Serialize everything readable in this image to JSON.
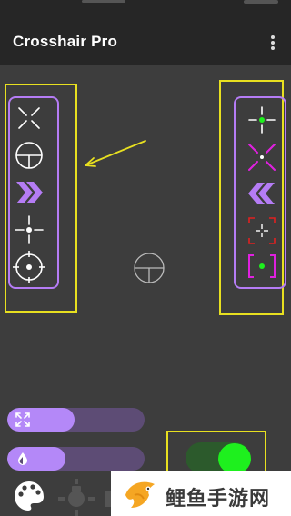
{
  "app": {
    "title": "Crosshair Pro"
  },
  "left_panel": {
    "items": [
      "x-crosshair",
      "circle-t-crosshair",
      "double-chevron-right",
      "dot-cross-crosshair",
      "circle-cross-dot-crosshair"
    ]
  },
  "right_panel": {
    "items": [
      "green-dot-cross-crosshair",
      "magenta-x-crosshair",
      "double-chevron-left",
      "red-bracket-cross-crosshair",
      "magenta-bracket-green-dot-crosshair"
    ]
  },
  "sliders": [
    {
      "name": "size",
      "icon": "expand-icon",
      "value": 0.49
    },
    {
      "name": "opacity",
      "icon": "drop-icon",
      "value": 0.42
    }
  ],
  "toggle": {
    "on": true
  },
  "colors": {
    "accent": "#b57cf5",
    "highlight": "#e8e020",
    "toggle_on": "#1ef01e",
    "background": "#3d3d3d",
    "appbar": "#262626"
  },
  "watermark": {
    "text": "鲤鱼手游网"
  }
}
